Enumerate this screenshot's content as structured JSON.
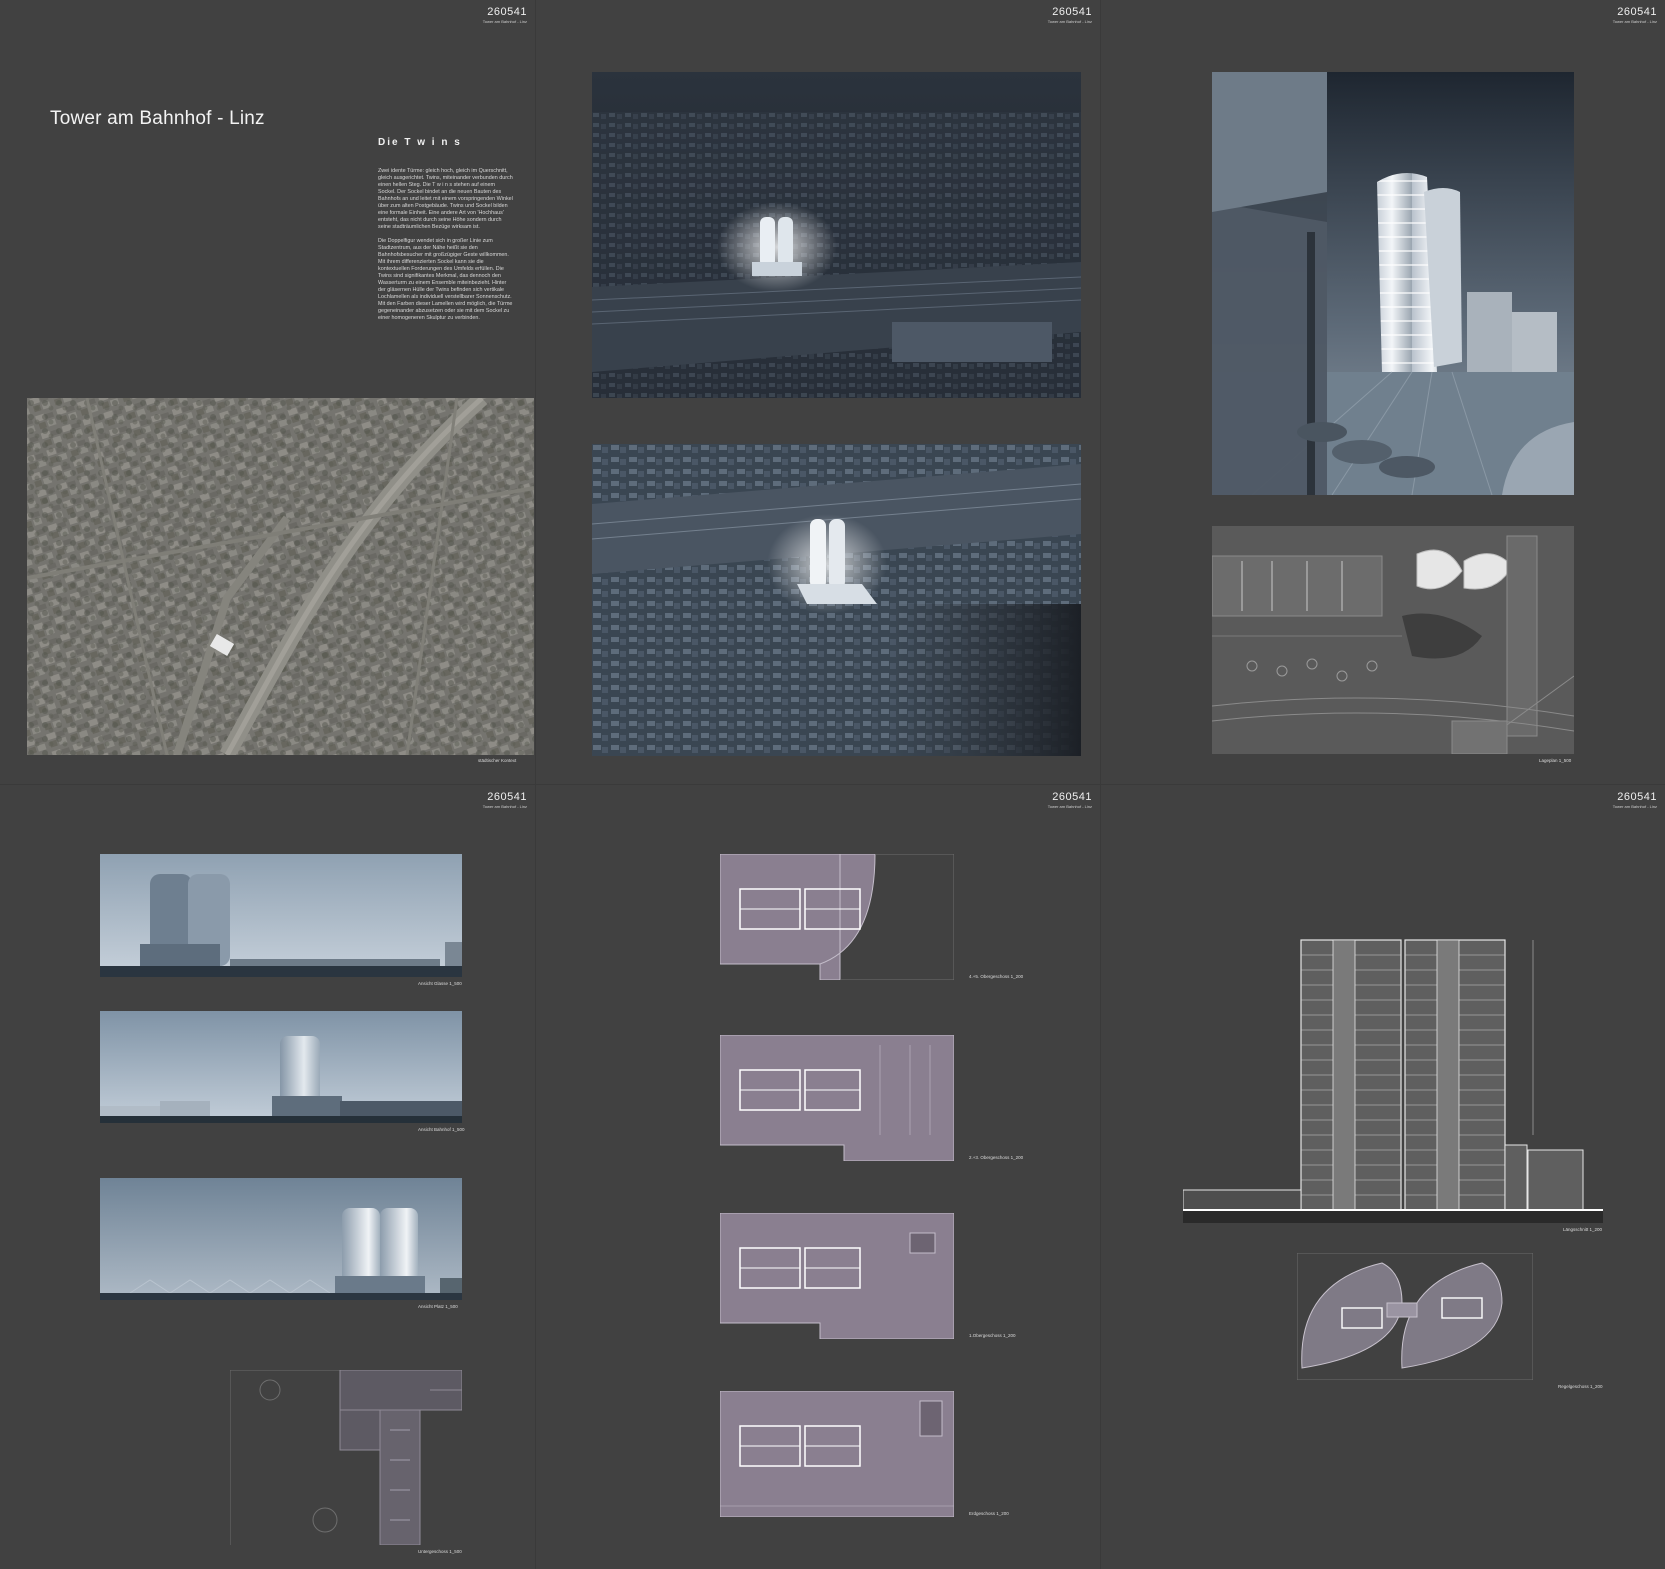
{
  "pages": [
    {
      "number": "260541",
      "subtitle": "Tower am Bahnhof - Linz"
    },
    {
      "number": "260541",
      "subtitle": "Tower am Bahnhof - Linz"
    },
    {
      "number": "260541",
      "subtitle": "Tower am Bahnhof - Linz"
    },
    {
      "number": "260541",
      "subtitle": "Tower am Bahnhof - Linz"
    },
    {
      "number": "260541",
      "subtitle": "Tower am Bahnhof - Linz"
    },
    {
      "number": "260541",
      "subtitle": "Tower am Bahnhof - Linz"
    }
  ],
  "intro": {
    "title": "Tower am Bahnhof - Linz",
    "subtitle": "Die T w i n s",
    "paragraph1": "Zwei idente Türme: gleich hoch, gleich im Querschnitt, gleich ausgerichtet. Twins, miteinander verbunden durch einen hellen Steg. Die T w i n s stehen auf einem Sockel. Der Sockel bindet an die neuen Bauten des Bahnhofs an und leitet mit einem vorspringenden Winkel über zum alten Postgebäude. Twins und Sockel bilden eine formale Einheit. Eine andere Art von 'Hochhaus' entsteht, das nicht durch seine Höhe sondern durch seine stadträumlichen Bezüge wirksam ist.",
    "paragraph2": "Die Doppelfigur wendet sich in großer Linie zum Stadtzentrum, aus der Nähe heißt sie den Bahnhofsbesucher mit großzügiger Geste willkommen. Mit ihrem differenzierten Sockel kann sie die kontextuellen Forderungen des Umfelds erfüllen. Die Twins sind signifikantes Merkmal, das dennoch den Wasserturm zu einem Ensemble miteinbezieht. Hinter der gläsernen Hülle der Twins befinden sich vertikale Lochlamellen als individuell verstellbarer Sonnenschutz. Mit den Farben dieser Lamellen wird möglich, die Türme gegeneinander abzusetzen oder sie mit dem Sockel zu einer homogeneren Skulptur zu verbinden."
  },
  "captions": {
    "context": "städtischer Kontext",
    "siteplan": "Lageplan 1_500",
    "elev_glass": "Ansicht Glasse 1_500",
    "elev_bahnhof": "Ansicht Bahnhof 1_500",
    "elev_platz": "Ansicht Platz 1_500",
    "basement": "Untergeschoss 1_500",
    "floor_4": "4.+5. Obergeschoss 1_200",
    "floor_2": "2.+3. Obergeschoss 1_200",
    "floor_1": "1.Obergeschoss 1_200",
    "floor_0": "Erdgeschoss 1_200",
    "section": "Längsschnitt 1_200",
    "typical": "Regelgeschoss 1_200"
  },
  "colors": {
    "background": "#414141",
    "plan_fill": "#8a7f90",
    "sky": "#a9b6c2"
  }
}
